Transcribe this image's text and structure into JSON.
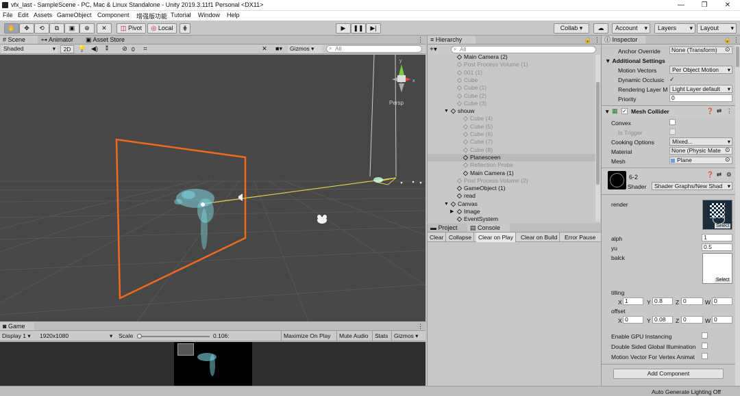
{
  "window": {
    "title": "vfx_last - SampleScene - PC, Mac & Linux Standalone - Unity 2019.3.11f1 Personal <DX11>",
    "minimize": "—",
    "maximize": "❐",
    "close": "✕"
  },
  "menu": [
    "File",
    "Edit",
    "Assets",
    "GameObject",
    "Component",
    "增强版功能",
    "Tutorial",
    "Window",
    "Help"
  ],
  "toolbar": {
    "pivot": "Pivot",
    "local": "Local",
    "collab": "Collab ▾",
    "account": "Account",
    "layers": "Layers",
    "layout": "Layout"
  },
  "scene": {
    "tabs": {
      "scene": "Scene",
      "animator": "Animator",
      "asset_store": "Asset Store"
    },
    "shading": "Shaded",
    "mode_2d": "2D",
    "fx_count": "0",
    "gizmos": "Gizmos",
    "search_placeholder": "All",
    "persp": "Persp"
  },
  "game": {
    "tab": "Game",
    "display": "Display 1",
    "resolution": "1920x1080",
    "scale_label": "Scale",
    "scale_value": "0.106:",
    "maximize": "Maximize On Play",
    "mute": "Mute Audio",
    "stats": "Stats",
    "gizmos": "Gizmos"
  },
  "hierarchy": {
    "tab": "Hierarchy",
    "search_placeholder": "All",
    "rows": [
      {
        "label": "Main Camera (2)",
        "dim": false,
        "indent": 1,
        "arrow": ""
      },
      {
        "label": "Post Process Volume (1)",
        "dim": true,
        "indent": 1,
        "arrow": ""
      },
      {
        "label": "001 (1)",
        "dim": true,
        "indent": 1,
        "arrow": ""
      },
      {
        "label": "Cube",
        "dim": true,
        "indent": 1,
        "arrow": ""
      },
      {
        "label": "Cube (1)",
        "dim": true,
        "indent": 1,
        "arrow": ""
      },
      {
        "label": "Cube (2)",
        "dim": true,
        "indent": 1,
        "arrow": ""
      },
      {
        "label": "Cube (3)",
        "dim": true,
        "indent": 1,
        "arrow": ""
      },
      {
        "label": "shouw",
        "dim": false,
        "indent": 0,
        "arrow": "▼"
      },
      {
        "label": "Cube (4)",
        "dim": true,
        "indent": 2,
        "arrow": ""
      },
      {
        "label": "Cube (5)",
        "dim": true,
        "indent": 2,
        "arrow": ""
      },
      {
        "label": "Cube (6)",
        "dim": true,
        "indent": 2,
        "arrow": ""
      },
      {
        "label": "Cube (7)",
        "dim": true,
        "indent": 2,
        "arrow": ""
      },
      {
        "label": "Cube (8)",
        "dim": true,
        "indent": 2,
        "arrow": ""
      },
      {
        "label": "Planesceen",
        "dim": false,
        "indent": 2,
        "arrow": "",
        "selected": true
      },
      {
        "label": "Reflection Probe",
        "dim": true,
        "indent": 2,
        "arrow": ""
      },
      {
        "label": "Main Camera (1)",
        "dim": false,
        "indent": 2,
        "arrow": ""
      },
      {
        "label": "Post Process Volume (2)",
        "dim": true,
        "indent": 1,
        "arrow": ""
      },
      {
        "label": "GameObject (1)",
        "dim": false,
        "indent": 1,
        "arrow": ""
      },
      {
        "label": "read",
        "dim": false,
        "indent": 1,
        "arrow": ""
      },
      {
        "label": "Canvas",
        "dim": false,
        "indent": 0,
        "arrow": "▼"
      },
      {
        "label": "Image",
        "dim": false,
        "indent": 1,
        "arrow": "▶"
      },
      {
        "label": "EventSystem",
        "dim": false,
        "indent": 1,
        "arrow": ""
      }
    ]
  },
  "console": {
    "tabs": {
      "project": "Project",
      "console": "Console"
    },
    "buttons": [
      "Clear",
      "Collapse",
      "Clear on Play",
      "Clear on Build",
      "Error Pause"
    ]
  },
  "inspector": {
    "tab": "Inspector",
    "anchor_override": {
      "label": "Anchor Override",
      "value": "None (Transform)"
    },
    "additional_settings": "Additional Settings",
    "motion_vectors": {
      "label": "Motion Vectors",
      "value": "Per Object Motion"
    },
    "dynamic_occlusion": {
      "label": "Dynamic Occlusic",
      "check": "✓"
    },
    "rendering_layer": {
      "label": "Rendering Layer M",
      "value": "Light Layer default"
    },
    "priority": {
      "label": "Priority",
      "value": "0"
    },
    "mesh_collider": {
      "title": "Mesh Collider",
      "check": "✓",
      "convex": "Convex",
      "is_trigger": "Is Trigger",
      "cooking": {
        "label": "Cooking Options",
        "value": "Mixed..."
      },
      "material": {
        "label": "Material",
        "value": "None (Physic Mate"
      },
      "mesh": {
        "label": "Mesh",
        "value": "Plane"
      }
    },
    "material": {
      "name": "6-2",
      "shader_label": "Shader",
      "shader": "Shader Graphs/New Shad",
      "render": "render",
      "select": "Select",
      "alph": {
        "label": "alph",
        "value": "1"
      },
      "yu": {
        "label": "yu",
        "value": "0.5"
      },
      "balck": "balck",
      "tilling": {
        "label": "tilling",
        "x": "1",
        "y": "0.8",
        "z": "0",
        "w": "0"
      },
      "offset": {
        "label": "offset",
        "x": "0",
        "y": "0.08",
        "z": "0",
        "w": "0"
      },
      "gpu_instancing": "Enable GPU Instancing",
      "double_sided": "Double Sided Global Illumination",
      "motion_vector": "Motion Vector For Vertex Animat"
    },
    "add_component": "Add Component"
  },
  "status": {
    "text": "Auto Generate Lighting Off"
  },
  "colors": {
    "scene_bg": "#474747",
    "selection": "#f06a1e",
    "particles": "#7fd6e0",
    "hier_selected": "#b9b9b9"
  }
}
